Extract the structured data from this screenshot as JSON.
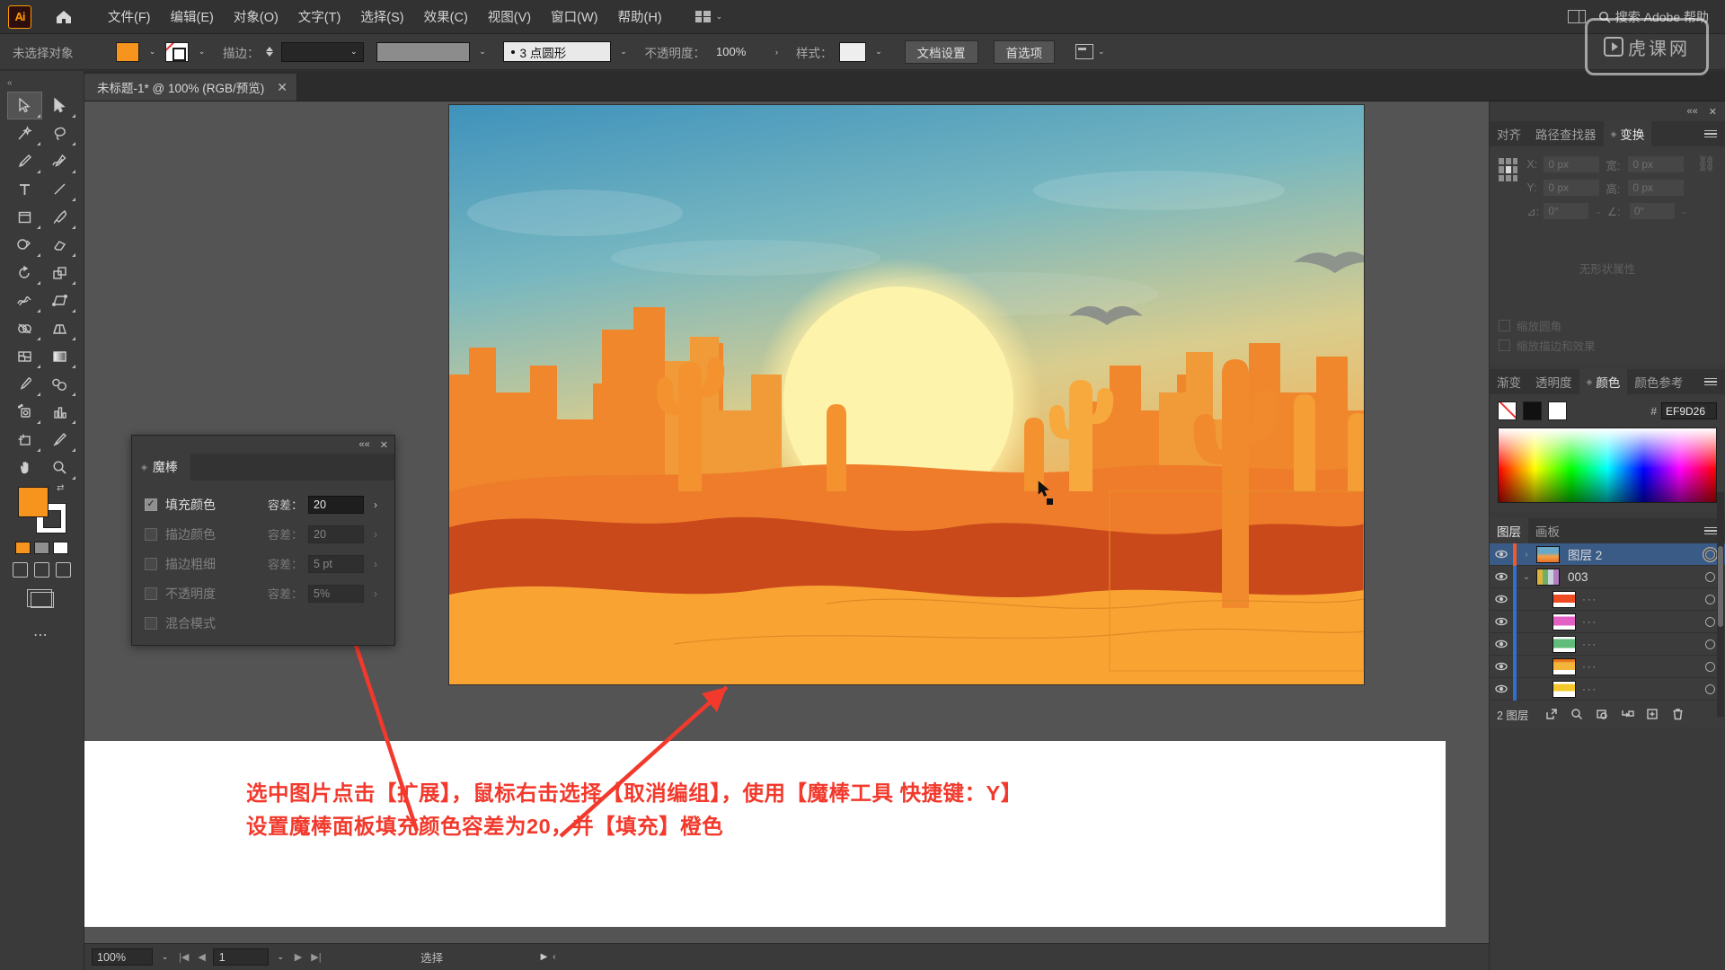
{
  "app": {
    "logo": "Ai",
    "home_icon": "home-icon"
  },
  "menubar": {
    "items": [
      {
        "label": "文件(F)"
      },
      {
        "label": "编辑(E)"
      },
      {
        "label": "对象(O)"
      },
      {
        "label": "文字(T)"
      },
      {
        "label": "选择(S)"
      },
      {
        "label": "效果(C)"
      },
      {
        "label": "视图(V)"
      },
      {
        "label": "窗口(W)"
      },
      {
        "label": "帮助(H)"
      }
    ],
    "arrange_caret": "⌄",
    "search_placeholder": "搜索 Adobe 帮助"
  },
  "controlbar": {
    "selection_status": "未选择对象",
    "fill_color": "#F7941E",
    "stroke_label": "描边：",
    "stroke_weight": "",
    "brush_label": "3 点圆形",
    "opacity_label": "不透明度：",
    "opacity_value": "100%",
    "style_label": "样式：",
    "doc_setup_button": "文档设置",
    "preferences_button": "首选项",
    "align_caret": "⌄"
  },
  "watermark": {
    "text": "虎课网"
  },
  "document_tab": {
    "title": "未标题-1* @ 100% (RGB/预览)",
    "close": "✕"
  },
  "toolbar": {
    "collapse": "«",
    "tools": [
      {
        "name": "selection-tool",
        "selected": true
      },
      {
        "name": "direct-selection-tool",
        "selected": false
      },
      {
        "name": "magic-wand-tool",
        "selected": false
      },
      {
        "name": "lasso-tool",
        "selected": false
      },
      {
        "name": "pen-tool",
        "selected": false
      },
      {
        "name": "curvature-tool",
        "selected": false
      },
      {
        "name": "type-tool",
        "selected": false
      },
      {
        "name": "line-segment-tool",
        "selected": false
      },
      {
        "name": "rectangle-tool",
        "selected": false
      },
      {
        "name": "paintbrush-tool",
        "selected": false
      },
      {
        "name": "shaper-tool",
        "selected": false
      },
      {
        "name": "eraser-tool",
        "selected": false
      },
      {
        "name": "rotate-tool",
        "selected": false
      },
      {
        "name": "scale-tool",
        "selected": false
      },
      {
        "name": "width-tool",
        "selected": false
      },
      {
        "name": "free-transform-tool",
        "selected": false
      },
      {
        "name": "shape-builder-tool",
        "selected": false
      },
      {
        "name": "perspective-grid-tool",
        "selected": false
      },
      {
        "name": "mesh-tool",
        "selected": false
      },
      {
        "name": "gradient-tool",
        "selected": false
      },
      {
        "name": "eyedropper-tool",
        "selected": false
      },
      {
        "name": "blend-tool",
        "selected": false
      },
      {
        "name": "symbol-sprayer-tool",
        "selected": false
      },
      {
        "name": "column-graph-tool",
        "selected": false
      },
      {
        "name": "artboard-tool",
        "selected": false
      },
      {
        "name": "slice-tool",
        "selected": false
      },
      {
        "name": "hand-tool",
        "selected": false
      },
      {
        "name": "zoom-tool",
        "selected": false
      }
    ],
    "fill_color": "#F7941E",
    "stroke_color": "#FFFFFF"
  },
  "wand_panel": {
    "tab_label": "魔棒",
    "close": "✕",
    "collapse": "««",
    "rows": [
      {
        "label": "填充颜色",
        "checked": true,
        "tol_label": "容差：",
        "tol_value": "20",
        "enabled": true
      },
      {
        "label": "描边颜色",
        "checked": false,
        "tol_label": "容差：",
        "tol_value": "20",
        "enabled": false
      },
      {
        "label": "描边粗细",
        "checked": false,
        "tol_label": "容差：",
        "tol_value": "5 pt",
        "enabled": false
      },
      {
        "label": "不透明度",
        "checked": false,
        "tol_label": "容差：",
        "tol_value": "5%",
        "enabled": false
      },
      {
        "label": "混合模式",
        "checked": false,
        "tol_label": "",
        "tol_value": "",
        "enabled": false
      }
    ]
  },
  "transform_panel": {
    "tabs": [
      {
        "label": "对齐",
        "active": false
      },
      {
        "label": "路径查找器",
        "active": false
      },
      {
        "label": "变换",
        "active": true
      }
    ],
    "close": "✕",
    "collapse": "««",
    "fields": [
      {
        "label": "X:",
        "value": "0 px"
      },
      {
        "label": "Y:",
        "value": "0 px"
      },
      {
        "label": "宽:",
        "value": "0 px"
      },
      {
        "label": "高:",
        "value": "0 px"
      }
    ],
    "angle_label": "⊿:",
    "angle_value": "0°",
    "shear_label": "∠:",
    "shear_value": "0°",
    "no_shape_note": "无形状属性",
    "checkbox_scale_corners": "缩放圆角",
    "checkbox_scale_strokes": "缩放描边和效果"
  },
  "color_panel": {
    "tabs": [
      {
        "label": "渐变",
        "active": false
      },
      {
        "label": "透明度",
        "active": false
      },
      {
        "label": "颜色",
        "active": true
      },
      {
        "label": "颜色参考",
        "active": false
      }
    ],
    "hex_prefix": "#",
    "hex_value": "EF9D26",
    "swatches": [
      "none",
      "#111111",
      "#FFFFFF"
    ]
  },
  "layers_panel": {
    "tabs": [
      {
        "label": "图层",
        "active": true
      },
      {
        "label": "画板",
        "active": false
      }
    ],
    "rows": [
      {
        "name": "图层 2",
        "indent": 0,
        "selected": true,
        "expander": "›",
        "thumb_kind": "sunset",
        "dots": "",
        "color": "#f05a28"
      },
      {
        "name": "003",
        "indent": 1,
        "selected": false,
        "expander": "⌄",
        "thumb_kind": "multi",
        "dots": "",
        "color": "#2f6fd0"
      },
      {
        "name": "",
        "indent": 2,
        "selected": false,
        "expander": "",
        "thumb_kind": "red",
        "dots": "···",
        "color": "#2f6fd0"
      },
      {
        "name": "",
        "indent": 2,
        "selected": false,
        "expander": "",
        "thumb_kind": "magenta",
        "dots": "···",
        "color": "#2f6fd0"
      },
      {
        "name": "",
        "indent": 2,
        "selected": false,
        "expander": "",
        "thumb_kind": "green",
        "dots": "···",
        "color": "#2f6fd0"
      },
      {
        "name": "",
        "indent": 2,
        "selected": false,
        "expander": "",
        "thumb_kind": "orange",
        "dots": "···",
        "color": "#2f6fd0"
      },
      {
        "name": "",
        "indent": 2,
        "selected": false,
        "expander": "",
        "thumb_kind": "yellow",
        "dots": "···",
        "color": "#2f6fd0"
      }
    ],
    "footer_count": "2 图层",
    "footer_icons": [
      "release-to-layers-icon",
      "locate-object-icon",
      "make-clipping-mask-icon",
      "create-sublayer-icon",
      "create-new-layer-icon",
      "delete-selection-icon"
    ]
  },
  "statusbar": {
    "zoom": "100%",
    "page": "1",
    "status_text": "选择",
    "first": "|◀",
    "prev": "◀",
    "next": "▶",
    "last": "▶|"
  },
  "annotation": {
    "line1": "选中图片点击【扩展】，鼠标右击选择【取消编组】，使用【魔棒工具 快捷键：Y】",
    "line2": "设置魔棒面板填充颜色容差为20，并【填充】橙色",
    "color": "#F2392C"
  },
  "artwork": {
    "description": "desert-sunset-illustration",
    "sky_top": "#4a9fc4",
    "sky_mid": "#e9d98a",
    "sun": "#fff6c6",
    "dune_front": "#f9a033",
    "dune_mid": "#e8712a",
    "rock": "#f08a2c",
    "dark_dune": "#c1451c"
  }
}
